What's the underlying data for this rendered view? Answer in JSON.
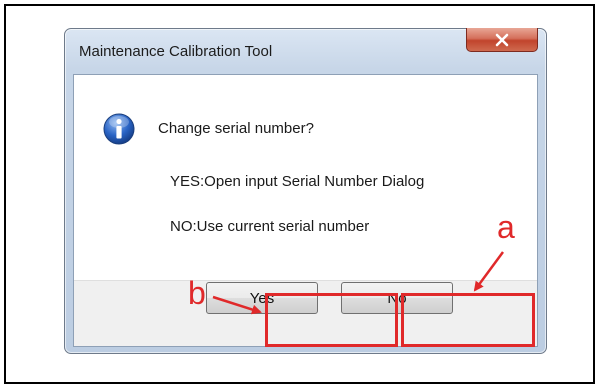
{
  "dialog": {
    "title": "Maintenance Calibration Tool",
    "close_icon": "close-icon",
    "info_icon": "information-icon",
    "message_lines": [
      "Change serial number?",
      "YES:Open input Serial Number Dialog",
      "NO:Use current serial number"
    ],
    "buttons": {
      "yes_label": "Yes",
      "no_label": "No"
    }
  },
  "annotations": {
    "label_a": "a",
    "label_b": "b",
    "color": "#e0292a"
  },
  "colors": {
    "close_button": "#c1442c",
    "title_bar": "#c7d6e8"
  }
}
